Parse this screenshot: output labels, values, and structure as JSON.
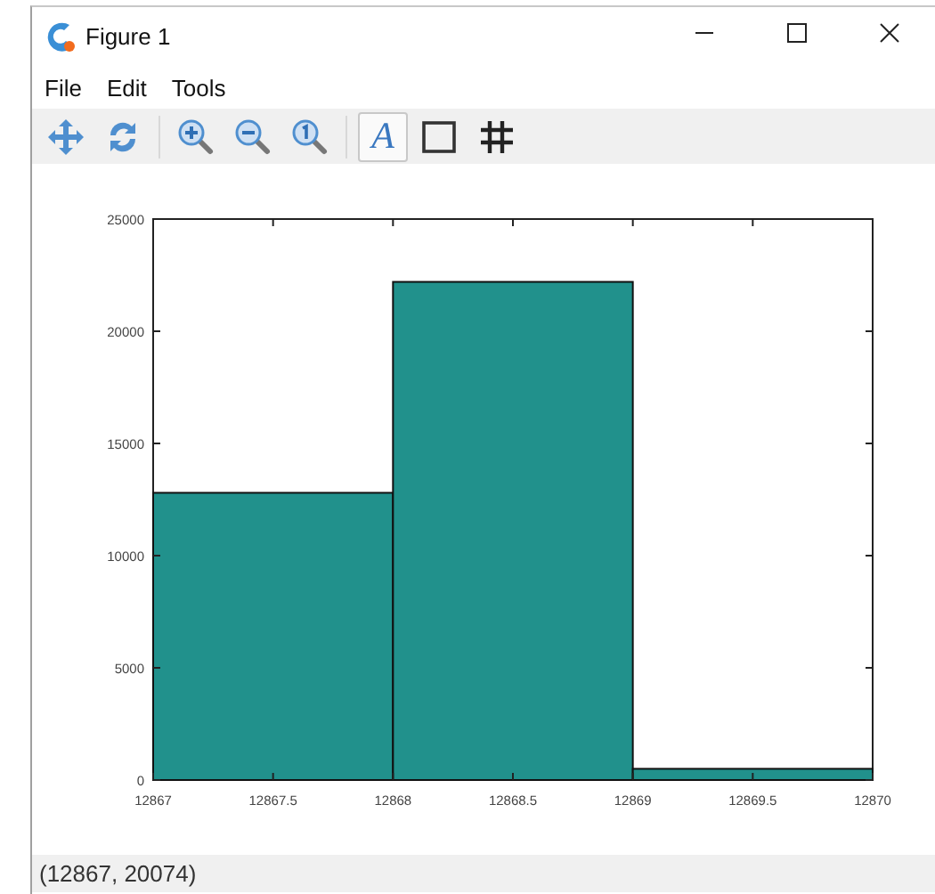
{
  "window": {
    "title": "Figure 1",
    "controls": [
      {
        "kind": "minimize"
      },
      {
        "kind": "maximize"
      },
      {
        "kind": "close"
      }
    ]
  },
  "menu": [
    "File",
    "Edit",
    "Tools"
  ],
  "toolbar": [
    {
      "kind": "pan",
      "on": false
    },
    {
      "kind": "rotate",
      "on": false
    },
    {
      "kind": "sep"
    },
    {
      "kind": "zoom-in",
      "on": false
    },
    {
      "kind": "zoom-out",
      "on": false
    },
    {
      "kind": "zoom-reset",
      "on": false
    },
    {
      "kind": "sep"
    },
    {
      "kind": "text",
      "label": "A",
      "on": true
    },
    {
      "kind": "box",
      "on": false
    },
    {
      "kind": "grid",
      "on": false
    }
  ],
  "plot": {
    "chart_data": {
      "type": "bar",
      "x": [
        12867.5,
        12868.5,
        12869.5
      ],
      "series": [
        {
          "color": "#21918c",
          "values": [
            12800,
            22200,
            500
          ]
        }
      ],
      "xlim": [
        12867,
        12870
      ],
      "ylim": [
        0,
        25000
      ],
      "xticks": [
        {
          "value": 12867,
          "label": "12867"
        },
        {
          "value": 12867.5,
          "label": "12867.5"
        },
        {
          "value": 12868,
          "label": "12868"
        },
        {
          "value": 12868.5,
          "label": "12868.5"
        },
        {
          "value": 12869,
          "label": "12869"
        },
        {
          "value": 12869.5,
          "label": "12869.5"
        },
        {
          "value": 12870,
          "label": "12870"
        }
      ],
      "yticks": [
        {
          "value": 0,
          "label": "0"
        },
        {
          "value": 5000,
          "label": "5000"
        },
        {
          "value": 10000,
          "label": "10000"
        },
        {
          "value": 15000,
          "label": "15000"
        },
        {
          "value": 20000,
          "label": "20000"
        },
        {
          "value": 25000,
          "label": "25000"
        }
      ]
    }
  },
  "status_bar": "(12867, 20074)"
}
